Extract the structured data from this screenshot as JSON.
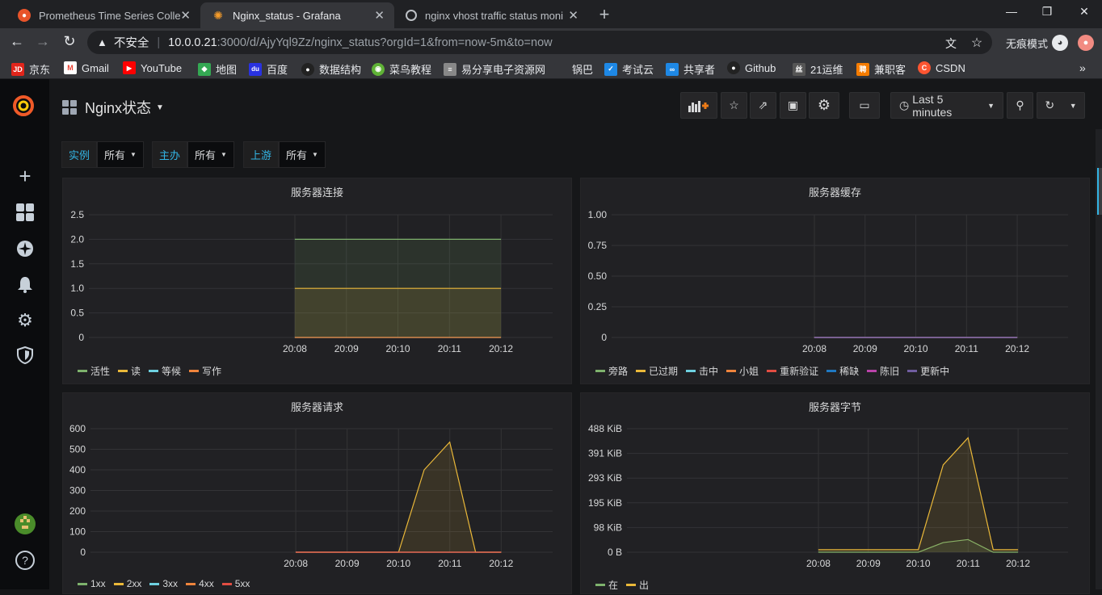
{
  "browser": {
    "tabs": [
      {
        "title": "Prometheus Time Series Colle",
        "icon": "firefox-like-icon"
      },
      {
        "title": "Nginx_status - Grafana",
        "icon": "grafana-icon",
        "active": true
      },
      {
        "title": "nginx vhost traffic status moni",
        "icon": "globe-icon"
      }
    ],
    "address": {
      "security": "不安全",
      "host": "10.0.0.21",
      "path": ":3000/d/AjyYql9Zz/nginx_status?orgId=1&from=now-5m&to=now"
    },
    "incognito_label": "无痕模式",
    "bookmarks": [
      {
        "label": "京东",
        "icon": "JD",
        "color": "#e1251b"
      },
      {
        "label": "Gmail",
        "icon": "M",
        "color": "#ea4335"
      },
      {
        "label": "YouTube",
        "icon": "▶",
        "color": "#ff0000"
      },
      {
        "label": "地图",
        "icon": "◆",
        "color": "#34a853"
      },
      {
        "label": "百度",
        "icon": "du",
        "color": "#2932e1"
      },
      {
        "label": "数据结构",
        "icon": "●",
        "color": "#444"
      },
      {
        "label": "菜鸟教程",
        "icon": "◉",
        "color": "#5fb236"
      },
      {
        "label": "易分享电子资源网",
        "icon": "≡",
        "color": "#888"
      },
      {
        "label": "锅巴",
        "icon": "",
        "color": "#35363a"
      },
      {
        "label": "考试云",
        "icon": "✓",
        "color": "#1e88e5"
      },
      {
        "label": "共享者",
        "icon": "∞",
        "color": "#1e88e5"
      },
      {
        "label": "Github",
        "icon": "●",
        "color": "#444"
      },
      {
        "label": "21运维",
        "icon": "丝",
        "color": "#555"
      },
      {
        "label": "兼职客",
        "icon": "聘",
        "color": "#f57c00"
      },
      {
        "label": "CSDN",
        "icon": "C",
        "color": "#fc5531"
      }
    ]
  },
  "dashboard": {
    "title": "Nginx状态",
    "time_range": "Last 5 minutes",
    "variables": [
      {
        "label": "实例",
        "value": "所有"
      },
      {
        "label": "主办",
        "value": "所有"
      },
      {
        "label": "上游",
        "value": "所有"
      }
    ]
  },
  "chart_data": [
    {
      "type": "area",
      "title": "服务器连接",
      "x": [
        "20:08",
        "20:09",
        "20:10",
        "20:11",
        "20:12"
      ],
      "y_ticks": [
        "2.5",
        "2.0",
        "1.5",
        "1.0",
        "0.5",
        "0"
      ],
      "ylim": [
        0,
        2.5
      ],
      "series": [
        {
          "name": "活性",
          "color": "#7eb26d",
          "points": [
            [
              20.1333,
              2
            ],
            [
              20.2,
              2
            ]
          ]
        },
        {
          "name": "读",
          "color": "#eab839",
          "points": [
            [
              20.1333,
              1
            ],
            [
              20.2,
              1
            ]
          ]
        },
        {
          "name": "等候",
          "color": "#6ed0e0",
          "points": [
            [
              20.1333,
              0
            ],
            [
              20.2,
              0
            ]
          ]
        },
        {
          "name": "写作",
          "color": "#ef843c",
          "points": [
            [
              20.1333,
              0
            ],
            [
              20.2,
              0
            ]
          ]
        }
      ]
    },
    {
      "type": "line",
      "title": "服务器缓存",
      "x": [
        "20:08",
        "20:09",
        "20:10",
        "20:11",
        "20:12"
      ],
      "y_ticks": [
        "1.00",
        "0.75",
        "0.50",
        "0.25",
        "0"
      ],
      "ylim": [
        0,
        1
      ],
      "series": [
        {
          "name": "旁路",
          "color": "#7eb26d",
          "points": [
            [
              20.1333,
              0
            ],
            [
              20.2,
              0
            ]
          ]
        },
        {
          "name": "已过期",
          "color": "#eab839",
          "points": [
            [
              20.1333,
              0
            ],
            [
              20.2,
              0
            ]
          ]
        },
        {
          "name": "击中",
          "color": "#6ed0e0",
          "points": [
            [
              20.1333,
              0
            ],
            [
              20.2,
              0
            ]
          ]
        },
        {
          "name": "小姐",
          "color": "#ef843c",
          "points": [
            [
              20.1333,
              0
            ],
            [
              20.2,
              0
            ]
          ]
        },
        {
          "name": "重新验证",
          "color": "#e24d42",
          "points": [
            [
              20.1333,
              0
            ],
            [
              20.2,
              0
            ]
          ]
        },
        {
          "name": "稀缺",
          "color": "#1f78c1",
          "points": [
            [
              20.1333,
              0
            ],
            [
              20.2,
              0
            ]
          ]
        },
        {
          "name": "陈旧",
          "color": "#ba43a9",
          "points": [
            [
              20.1333,
              0
            ],
            [
              20.2,
              0
            ]
          ]
        },
        {
          "name": "更新中",
          "color": "#705da0",
          "points": [
            [
              20.1333,
              0
            ],
            [
              20.2,
              0
            ]
          ]
        }
      ]
    },
    {
      "type": "area",
      "title": "服务器请求",
      "x": [
        "20:08",
        "20:09",
        "20:10",
        "20:11",
        "20:12"
      ],
      "y_ticks": [
        "600",
        "500",
        "400",
        "300",
        "200",
        "100",
        "0"
      ],
      "ylim": [
        0,
        600
      ],
      "series": [
        {
          "name": "1xx",
          "color": "#7eb26d",
          "points": [
            [
              20.1333,
              0
            ],
            [
              20.2,
              0
            ]
          ]
        },
        {
          "name": "2xx",
          "color": "#eab839",
          "points": [
            [
              20.1333,
              0
            ],
            [
              20.1667,
              0
            ],
            [
              20.175,
              400
            ],
            [
              20.1833,
              535
            ],
            [
              20.1917,
              0
            ],
            [
              20.2,
              0
            ]
          ]
        },
        {
          "name": "3xx",
          "color": "#6ed0e0",
          "points": [
            [
              20.1333,
              0
            ],
            [
              20.2,
              0
            ]
          ]
        },
        {
          "name": "4xx",
          "color": "#ef843c",
          "points": [
            [
              20.1333,
              0
            ],
            [
              20.2,
              0
            ]
          ]
        },
        {
          "name": "5xx",
          "color": "#e24d42",
          "points": [
            [
              20.1333,
              0
            ],
            [
              20.2,
              0
            ]
          ]
        }
      ]
    },
    {
      "type": "area",
      "title": "服务器字节",
      "x": [
        "20:08",
        "20:09",
        "20:10",
        "20:11",
        "20:12"
      ],
      "y_ticks": [
        "488 KiB",
        "391 KiB",
        "293 KiB",
        "195 KiB",
        "98 KiB",
        "0 B"
      ],
      "ylim": [
        0,
        488
      ],
      "series": [
        {
          "name": "在",
          "color": "#7eb26d",
          "points": [
            [
              20.1333,
              0
            ],
            [
              20.1667,
              0
            ],
            [
              20.175,
              38
            ],
            [
              20.1833,
              50
            ],
            [
              20.1917,
              0
            ],
            [
              20.2,
              0
            ]
          ]
        },
        {
          "name": "出",
          "color": "#eab839",
          "points": [
            [
              20.1333,
              10
            ],
            [
              20.1667,
              10
            ],
            [
              20.175,
              345
            ],
            [
              20.1833,
              452
            ],
            [
              20.1917,
              10
            ],
            [
              20.2,
              10
            ]
          ]
        }
      ]
    }
  ]
}
